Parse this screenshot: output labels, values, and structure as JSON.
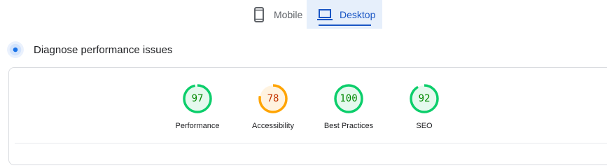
{
  "device_tabs": {
    "mobile": {
      "label": "Mobile",
      "icon": "smartphone-icon",
      "selected": false
    },
    "desktop": {
      "label": "Desktop",
      "icon": "laptop-icon",
      "selected": true
    }
  },
  "diagnose": {
    "title": "Diagnose performance issues",
    "icon": "lighthouse-icon"
  },
  "colors": {
    "pass": "#0cce6b",
    "pass_text": "#008800",
    "average": "#ffa400",
    "average_text": "#c33300",
    "accent": "#1a56c4"
  },
  "scores": [
    {
      "label": "Performance",
      "value": "97",
      "status": "pass"
    },
    {
      "label": "Accessibility",
      "value": "78",
      "status": "average"
    },
    {
      "label": "Best Practices",
      "value": "100",
      "status": "pass"
    },
    {
      "label": "SEO",
      "value": "92",
      "status": "pass"
    }
  ]
}
